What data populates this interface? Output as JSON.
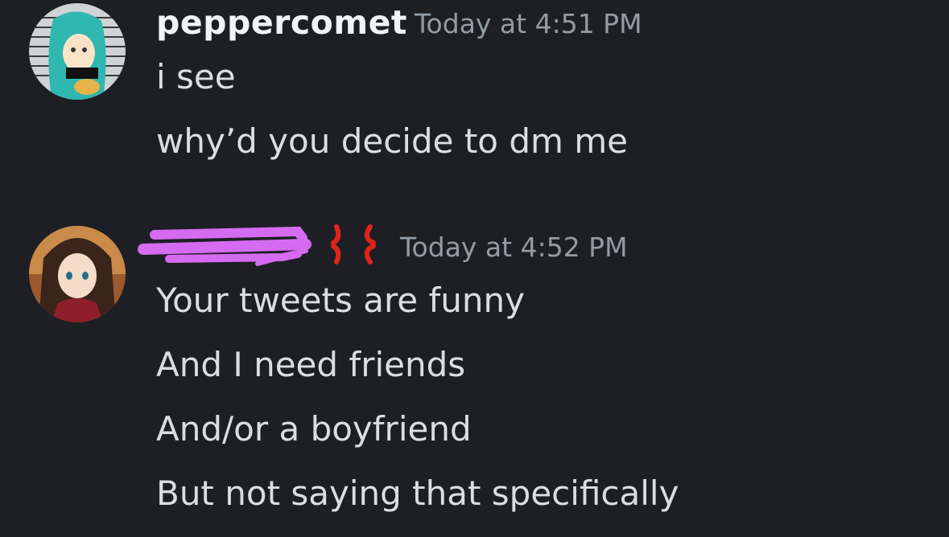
{
  "messages": [
    {
      "author": "peppercomet",
      "timestamp": "Today at 4:51 PM",
      "avatar": "anime-girl-avatar-teal-hair",
      "lines": [
        "i see",
        "why’d you decide to dm me"
      ]
    },
    {
      "author_redacted": true,
      "badge_icon": "anger-symbol-icon",
      "timestamp": "Today at 4:52 PM",
      "avatar": "anime-girl-avatar-brown-hair",
      "lines": [
        "Your tweets are funny",
        "And I need friends",
        "And/or a boyfriend",
        "But not saying that specifically"
      ]
    }
  ],
  "colors": {
    "background": "#1e1f25",
    "username": "#f2f3f5",
    "timestamp": "#949ba4",
    "text": "#dbdee1",
    "redaction": "#d56bf0",
    "anger": "#e2231a"
  }
}
